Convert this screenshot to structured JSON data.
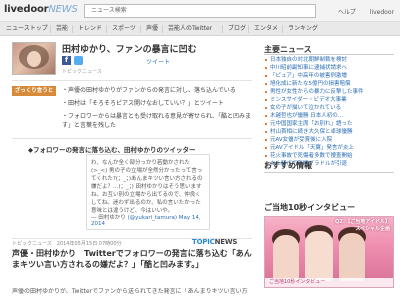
{
  "header": {
    "logo_main": "livedoor",
    "logo_sub": "NEWS",
    "search_value": "ニュース検索",
    "links": [
      "ヘルプ",
      "livedoor"
    ]
  },
  "nav": {
    "items": [
      "ニューストップ",
      "芸能",
      "トレンド",
      "スポーツ",
      "声優",
      "芸能人のTwitter",
      "ブログ",
      "エンタメ",
      "ランキング"
    ]
  },
  "article": {
    "title": "田村ゆかり、ファンの暴言に凹む",
    "tweet_label": "ツイート",
    "source": "トピックニュース",
    "badge": "ざっくり言うと",
    "summary": [
      "・声優の田村ゆかりがファンからの発言に対し、落ち込んでいる",
      "・田村は「そろそろピアス開けなおしていい？」とツイート",
      "・フォロワーからは暴言とも受け取れる意見が寄せられ、「酷と凹みます」と言葉を残した"
    ],
    "quote_heading": "◆フォロワーの発言に落ち込む、田村ゆかりのツイッター",
    "quote_text": "わ、なんか全く部分っかり若動かされた(>_<) 男の子の立場が全然分かったって言ってくれた?(；_；)あんまキツい言い方されるの嫌だよ？…(；_；) 田村ゆかりはそう思いますね。お互い別の立場から出てるので、仲良くしてね。迷わず出るのか、私の言いたかった意味とは違うけど、今はいいや。",
    "quote_author": "— 田村ゆかり",
    "quote_handle": "(@yukari_tamura)",
    "quote_date": "May 14, 2014",
    "topic_meta": "トピックニュース　2014年05月15日 07時00分",
    "topic_logo_a": "TOPIC",
    "topic_logo_b": "NEWS",
    "topic_title": "声優・田村ゆかり　Twitterでフォロワーの発言に落ち込む「あんまキツい言い方されるの嫌だよ？」「酷と凹みます。」",
    "body_start": "声優の田村ゆかりが、Twitterでファンから送られてきた発言に「あんまりキツい言い方",
    "title_jp": ""
  },
  "sidebar": {
    "news_heading": "主要ニュース",
    "news": [
      "日本独自の対北朝鮮制裁を検討",
      "中川昭前副知事に逮捕状請求へ",
      "「ピュア」中高年の被害例激増",
      "旭化成に新たな5億円の損害賠償",
      "男性が女性からの暴力に反撃した事件",
      "ミンスサイダー・ビデオ大事業",
      "女の子が描いて泣かれている",
      "木越哲也が優勝 日本人初の…",
      "元中国国家主席「お別れ」語った",
      "村山首相に続き大久保と卓球優勝",
      "元AV女優が受賞後に入院",
      "元AVアイドル「天翼」発言が炎上",
      "花火事故で死傷者多数で捜査開始",
      "炎上騒ぎで新聞グラドルが引退"
    ],
    "reco_heading": "おすすめ情報",
    "reco_sub": "ご当地10秒インタビュー",
    "video_caption": "Q2：【ご当地アイドル】スペシャル企画",
    "video_bar": "ご当地10秒インタビュー"
  }
}
